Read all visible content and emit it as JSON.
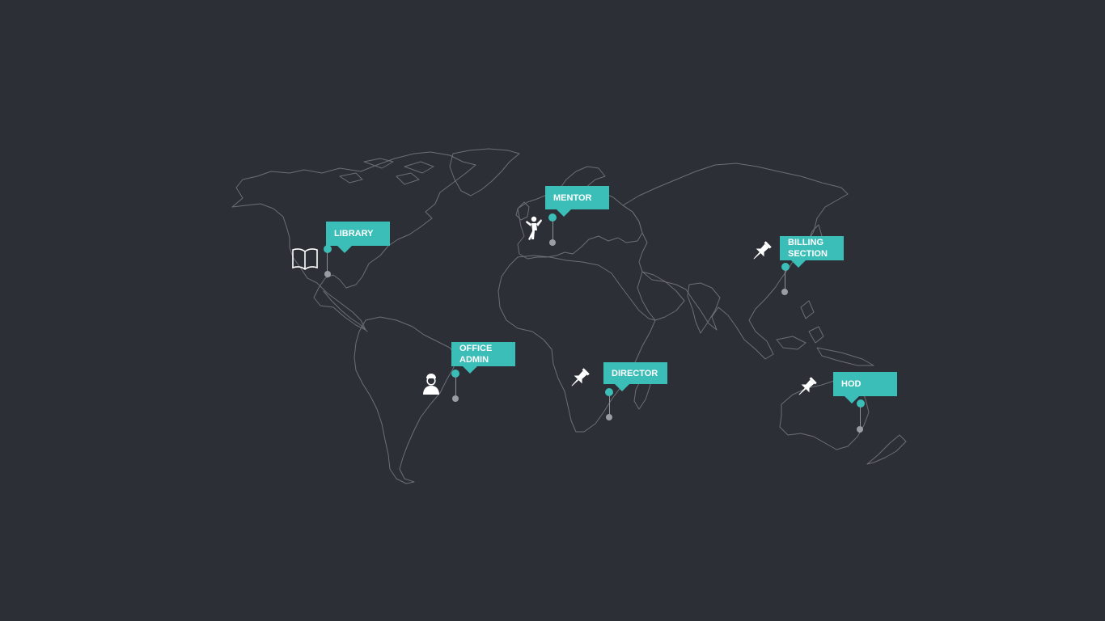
{
  "map": {
    "background": "#2c2f35",
    "outline_color": "#6c6f74",
    "accent": "#3bbdb8"
  },
  "markers": [
    {
      "id": "library",
      "label": "LIBRARY",
      "icon": "open-book-icon"
    },
    {
      "id": "mentor",
      "label": "MENTOR",
      "icon": "person-presenting-icon"
    },
    {
      "id": "billing",
      "label": "BILLING SECTION",
      "icon": "push-pin-icon"
    },
    {
      "id": "office-admin",
      "label": "OFFICE ADMIN",
      "icon": "user-avatar-icon"
    },
    {
      "id": "director",
      "label": "DIRECTOR",
      "icon": "push-pin-icon"
    },
    {
      "id": "hod",
      "label": "HOD",
      "icon": "push-pin-icon"
    }
  ]
}
